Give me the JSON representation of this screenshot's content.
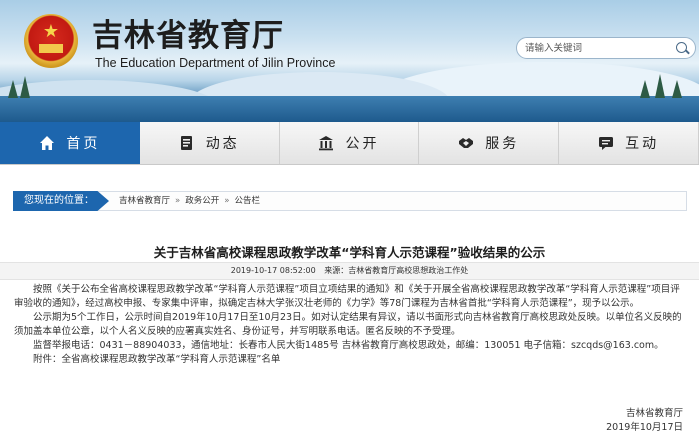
{
  "header": {
    "title_cn": "吉林省教育厅",
    "title_en": "The Education Department of Jilin Province",
    "search_placeholder": "请输入关键词"
  },
  "nav": [
    {
      "label": "首页",
      "icon": "home-icon",
      "active": true
    },
    {
      "label": "动态",
      "icon": "document-icon",
      "active": false
    },
    {
      "label": "公开",
      "icon": "building-icon",
      "active": false
    },
    {
      "label": "服务",
      "icon": "handshake-icon",
      "active": false
    },
    {
      "label": "互动",
      "icon": "chat-icon",
      "active": false
    }
  ],
  "breadcrumb": {
    "label": "您现在的位置：",
    "items": [
      "吉林省教育厅",
      "政务公开",
      "公告栏"
    ],
    "separator": "»"
  },
  "article": {
    "title": "关于吉林省高校课程思政教学改革“学科育人示范课程”验收结果的公示",
    "date": "2019-10-17 08:52:00",
    "source": "来源：吉林省教育厅高校思想政治工作处",
    "paragraphs": [
      "按照《关于公布全省高校课程思政教学改革“学科育人示范课程”项目立项结果的通知》和《关于开展全省高校课程思政教学改革“学科育人示范课程”项目评审验收的通知》，经过高校申报、专家集中评审，拟确定吉林大学张汉壮老师的《力学》等78门课程为吉林省首批“学科育人示范课程”，现予以公示。",
      "公示期为5个工作日，公示时间自2019年10月17日至10月23日。如对认定结果有异议，请以书面形式向吉林省教育厅高校思政处反映。以单位名义反映的须加盖本单位公章，以个人名义反映的应署真实姓名、身份证号，并写明联系电话。匿名反映的不予受理。",
      "监督举报电话：0431－88904033，通信地址：长春市人民大街1485号 吉林省教育厅高校思政处，邮编：130051 电子信箱：szcqds@163.com。",
      "附件：全省高校课程思政教学改革“学科育人示范课程”名单"
    ],
    "signature": "吉林省教育厅",
    "sign_date": "2019年10月17日"
  },
  "colors": {
    "primary_blue": "#1d66ae",
    "nav_bg": "#ececec"
  }
}
